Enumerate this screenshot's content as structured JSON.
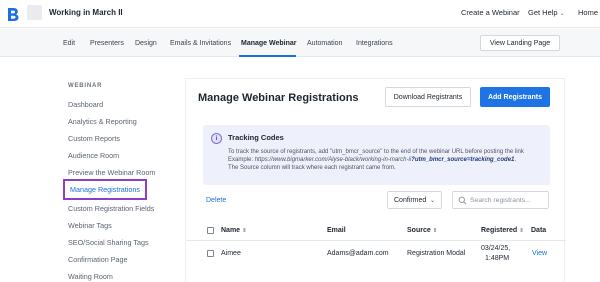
{
  "header": {
    "webinar_title": "Working in March II",
    "nav": [
      {
        "label": "Create a Webinar"
      },
      {
        "label": "Get Help"
      },
      {
        "label": "Home"
      }
    ]
  },
  "subnav": {
    "tabs": [
      "Edit",
      "Presenters",
      "Design",
      "Emails & Invitations",
      "Manage Webinar",
      "Automation",
      "Integrations"
    ],
    "active_tab": "Manage Webinar",
    "landing_button": "View Landing Page"
  },
  "sidebar": {
    "heading": "WEBINAR",
    "items": [
      "Dashboard",
      "Analytics & Reporting",
      "Custom Reports",
      "Audience Room",
      "Preview the Webinar Room",
      "Manage Registrations",
      "Custom Registration Fields",
      "Webinar Tags",
      "SEO/Social Sharing Tags",
      "Confirmation Page",
      "Waiting Room"
    ],
    "active_item": "Manage Registrations"
  },
  "main": {
    "title": "Manage Webinar Registrations",
    "download_button": "Download Registrants",
    "add_button": "Add Registrants",
    "tracking": {
      "title": "Tracking Codes",
      "line1": "To track the source of registrants, add \"utm_bmcr_source\" to the end of the webinar URL before posting the link",
      "line2_prefix": "Example: ",
      "line2_url": "https://www.bigmarker.com/Alyse-black/working-in-march-ii",
      "line2_param": "?utm_bmcr_source=tracking_code1",
      "line2_suffix": ".",
      "line3": "The Source column will track where each registrant came from."
    },
    "delete_label": "Delete",
    "filter_value": "Confirmed",
    "search_placeholder": "Search registrants...",
    "table": {
      "columns": [
        "Name",
        "Email",
        "Source",
        "Registered",
        "Data"
      ],
      "rows": [
        {
          "name": "Aimee",
          "email": "Adams@adam.com",
          "source": "Registration Modal",
          "registered_date": "03/24/25,",
          "registered_time": "1:48PM",
          "data_link": "View"
        }
      ]
    }
  },
  "colors": {
    "accent": "#1e74e4",
    "highlight_box": "#8b3fc7",
    "info_bg": "#eef0fb"
  }
}
